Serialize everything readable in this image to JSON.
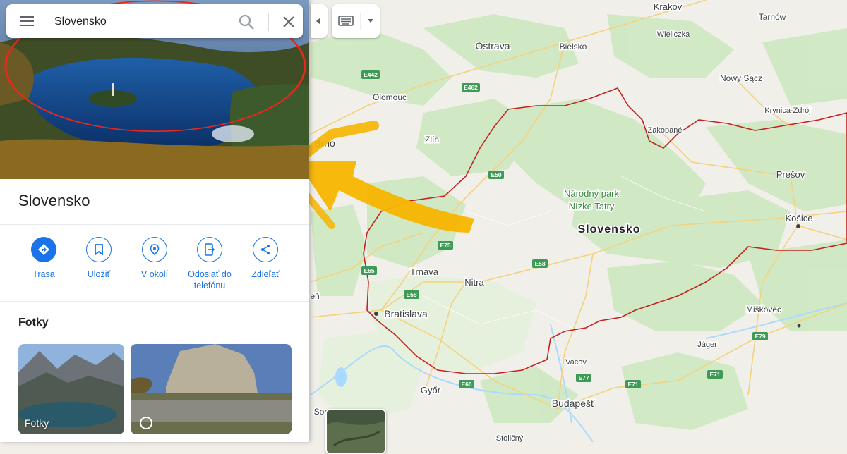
{
  "search": {
    "value": "Slovensko"
  },
  "place": {
    "title": "Slovensko"
  },
  "actions": [
    {
      "label": "Trasa",
      "icon": "directions-icon"
    },
    {
      "label": "Uložiť",
      "icon": "bookmark-icon"
    },
    {
      "label": "V okolí",
      "icon": "nearby-icon"
    },
    {
      "label": "Odoslať do telefónu",
      "icon": "send-to-phone-icon"
    },
    {
      "label": "Zdieľať",
      "icon": "share-icon"
    }
  ],
  "photos": {
    "heading": "Fotky",
    "first_label": "Fotky",
    "second_icon": "360-icon"
  },
  "map": {
    "country_label": "Slovensko",
    "region_label_line1": "Národný park",
    "region_label_line2": "Nízke Tatry",
    "places": [
      "Krakov",
      "Tarnów",
      "Wieliczka",
      "Ostrava",
      "Bielsko",
      "Olomouc",
      "Nowy Sącz",
      "Krynica-Zdrój",
      "Zakopané",
      "Brno",
      "Zlín",
      "Prešov",
      "Košice",
      "Trnava",
      "Nitra",
      "Bratislava",
      "Miškovec",
      "Jáger",
      "Vacov",
      "Győr",
      "Budapešť",
      "Sopron",
      "Stoličný",
      "eň"
    ],
    "roads": [
      "E442",
      "E462",
      "E50",
      "E75",
      "E65",
      "E58",
      "E58",
      "E79",
      "E77",
      "E71",
      "E71",
      "E60"
    ]
  },
  "colors": {
    "accent": "#1a73e8",
    "border": "#c5221f",
    "highlight_circle": "#e8281e",
    "arrow": "#f7b500"
  }
}
